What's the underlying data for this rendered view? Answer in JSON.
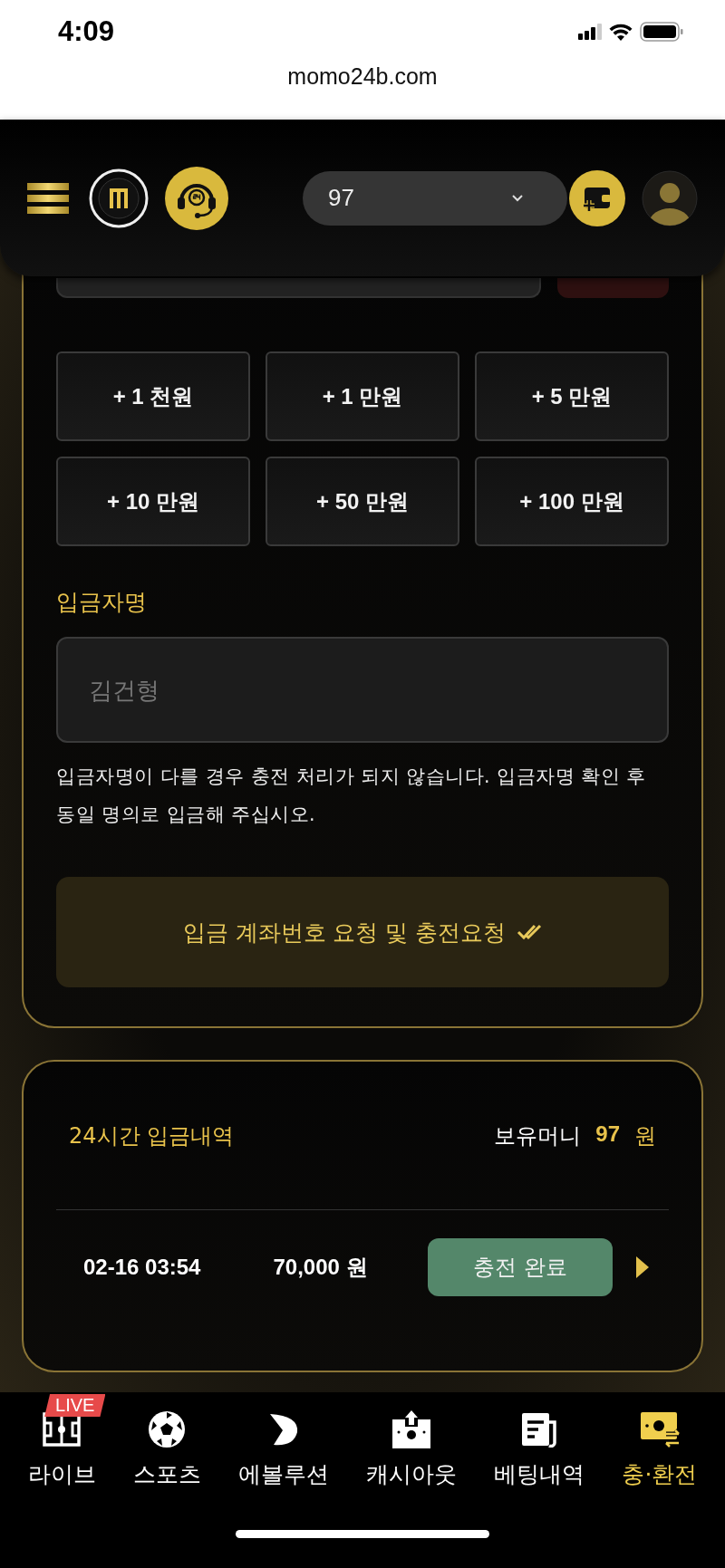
{
  "status_bar": {
    "time": "4:09"
  },
  "address_bar": {
    "url": "momo24b.com"
  },
  "header": {
    "balance": "97"
  },
  "amount_chips": [
    "+ 1 천원",
    "+ 1 만원",
    "+ 5 만원",
    "+ 10 만원",
    "+ 50 만원",
    "+ 100 만원"
  ],
  "depositor": {
    "label": "입금자명",
    "placeholder": "김건형"
  },
  "notice": "입금자명이 다를 경우 충전 처리가 되지 않습니다. 입금자명 확인 후 동일 명의로 입금해 주십시오.",
  "submit_button": {
    "label": "입금 계좌번호 요청 및 충전요청"
  },
  "history": {
    "title": "24시간 입금내역",
    "balance_label": "보유머니",
    "balance_value": "97",
    "balance_unit": "원",
    "rows": [
      {
        "time": "02-16 03:54",
        "amount": "70,000 원",
        "status": "충전 완료"
      }
    ]
  },
  "bottom_nav": [
    {
      "kind": "live",
      "label": "라이브",
      "badge": "LIVE",
      "selected": false
    },
    {
      "kind": "sports",
      "label": "스포츠",
      "selected": false
    },
    {
      "kind": "evolution",
      "label": "에볼루션",
      "selected": false
    },
    {
      "kind": "cashout",
      "label": "캐시아웃",
      "selected": false
    },
    {
      "kind": "history",
      "label": "베팅내역",
      "selected": false
    },
    {
      "kind": "exchange",
      "label": "충·환전",
      "selected": true
    }
  ]
}
